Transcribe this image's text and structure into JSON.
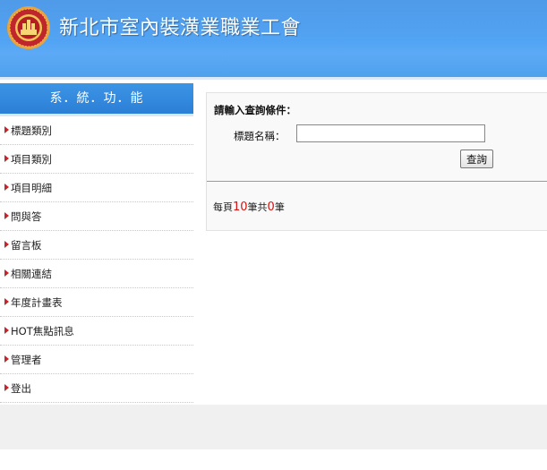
{
  "header": {
    "title": "新北市室內裝潢業職業工會"
  },
  "sidebar": {
    "title": "系．統．功．能",
    "items": [
      {
        "label": "標題類別"
      },
      {
        "label": "項目類別"
      },
      {
        "label": "項目明細"
      },
      {
        "label": "問與答"
      },
      {
        "label": "留言板"
      },
      {
        "label": "相關連結"
      },
      {
        "label": "年度計畫表"
      },
      {
        "label": "HOT焦點訊息"
      },
      {
        "label": "管理者"
      },
      {
        "label": "登出"
      }
    ]
  },
  "query": {
    "heading": "請輸入查詢條件：",
    "field_label": "標題名稱：",
    "field_value": "",
    "search_label": "查詢"
  },
  "paging": {
    "prefix": "每頁",
    "per_page": "10",
    "middle": "筆共",
    "total": "0",
    "suffix": "筆"
  },
  "colors": {
    "header_blue": "#4da0f2",
    "arrow_red": "#c0272d",
    "count_red": "#d11414"
  }
}
